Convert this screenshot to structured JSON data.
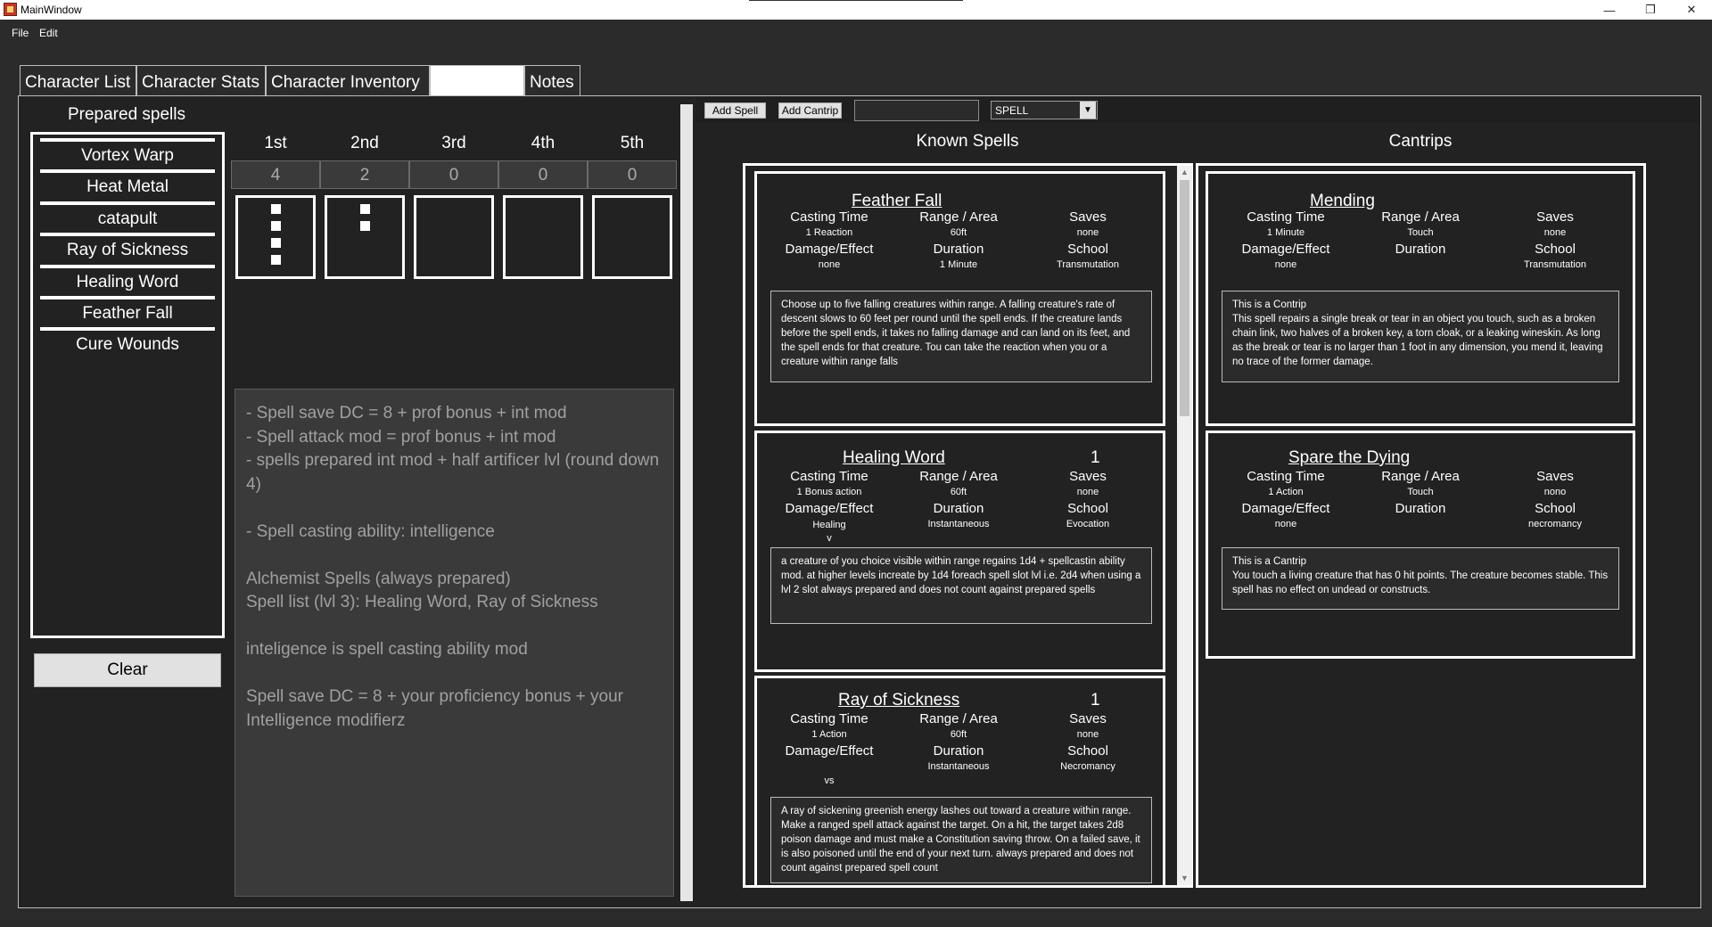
{
  "window": {
    "title": "MainWindow",
    "minimize_icon": "minimize-icon",
    "restore_icon": "restore-icon",
    "close_icon": "close-icon"
  },
  "menu": [
    "File",
    "Edit"
  ],
  "tabs": [
    {
      "label": "Character List"
    },
    {
      "label": "Character Stats"
    },
    {
      "label": "Character Inventory"
    },
    {
      "label": ""
    },
    {
      "label": "Notes"
    }
  ],
  "prepared": {
    "title": "Prepared spells",
    "items": [
      "Vortex Warp",
      "Heat Metal",
      "catapult",
      "Ray of Sickness",
      "Healing Word",
      "Feather Fall",
      "Cure Wounds"
    ],
    "clear_label": "Clear"
  },
  "slots": [
    {
      "level": "1st",
      "count": "4",
      "pips": 4
    },
    {
      "level": "2nd",
      "count": "2",
      "pips": 2
    },
    {
      "level": "3rd",
      "count": "0",
      "pips": 0
    },
    {
      "level": "4th",
      "count": "0",
      "pips": 0
    },
    {
      "level": "5th",
      "count": "0",
      "pips": 0
    }
  ],
  "notes": "- Spell save DC = 8 + prof bonus + int mod\n- Spell attack mod = prof bonus + int mod\n- spells prepared int mod + half artificer lvl (round down 4)\n\n- Spell casting ability: intelligence\n\nAlchemist Spells (always prepared)\nSpell list (lvl 3): Healing Word, Ray of Sickness\n\ninteligence is spell casting ability mod\n\nSpell save DC = 8 + your proficiency bonus + your Intelligence modifierz",
  "toolbar": {
    "add_spell": "Add Spell",
    "add_cantrip": "Add Cantrip",
    "search_value": "",
    "type_selected": "SPELL"
  },
  "headings": {
    "known": "Known Spells",
    "cantrips": "Cantrips"
  },
  "labels": {
    "casting_time": "Casting Time",
    "range": "Range / Area",
    "saves": "Saves",
    "damage": "Damage/Effect",
    "duration": "Duration",
    "school": "School"
  },
  "known_spells": [
    {
      "name": "Feather Fall",
      "level": "",
      "casting_time": "1 Reaction",
      "range": "60ft",
      "saves": "none",
      "damage": "none",
      "duration": "1 Minute",
      "school": "Transmutation",
      "description": "Choose up to five falling creatures within range. A falling creature's rate of descent slows to 60 feet per round until the spell ends. If the creature lands before the spell ends, it takes no falling damage and can land on its feet, and the spell ends for that creature. Tou can take the reaction when you or a creature within range falls"
    },
    {
      "name": "Healing Word",
      "level": "1",
      "casting_time": "1 Bonus action",
      "range": "60ft",
      "saves": "none",
      "damage": "Healing\nv",
      "duration": "Instantaneous",
      "school": "Evocation",
      "description": "a creature of you choice visible within range regains 1d4 + spellcastin ability mod. at higher levels increate by 1d4 foreach spell slot lvl i.e. 2d4 when using a lvl 2 slot always prepared and does not count against prepared spells"
    },
    {
      "name": "Ray of Sickness",
      "level": "1",
      "casting_time": "1 Action",
      "range": "60ft",
      "saves": "none",
      "damage": "\nvs",
      "duration": "Instantaneous",
      "school": "Necromancy",
      "description": "A ray of sickening greenish energy lashes out toward a creature within range. Make a ranged spell attack against the target. On a hit, the target takes 2d8 poison damage and must make a Constitution saving throw. On a failed save, it is also poisoned until the end of your next turn. always prepared and does not count against prepared spell count"
    }
  ],
  "cantrips": [
    {
      "name": "Mending",
      "casting_time": "1 Minute",
      "range": "Touch",
      "saves": "none",
      "damage": "none",
      "duration": "",
      "school": "Transmutation",
      "description": "This is a Contrip\nThis spell repairs a single break or tear in an object you touch, such as a broken chain link, two halves of a broken key, a torn cloak, or a leaking wineskin. As long as the break or tear is no larger than 1 foot in any dimension, you mend it, leaving no trace of the former damage."
    },
    {
      "name": "Spare the Dying",
      "casting_time": "1 Action",
      "range": "Touch",
      "saves": "nono",
      "damage": "none",
      "duration": "",
      "school": "necromancy",
      "description": "This is a Cantrip\nYou touch a living creature that has 0 hit points. The creature becomes stable. This spell has no effect on undead or constructs."
    }
  ]
}
